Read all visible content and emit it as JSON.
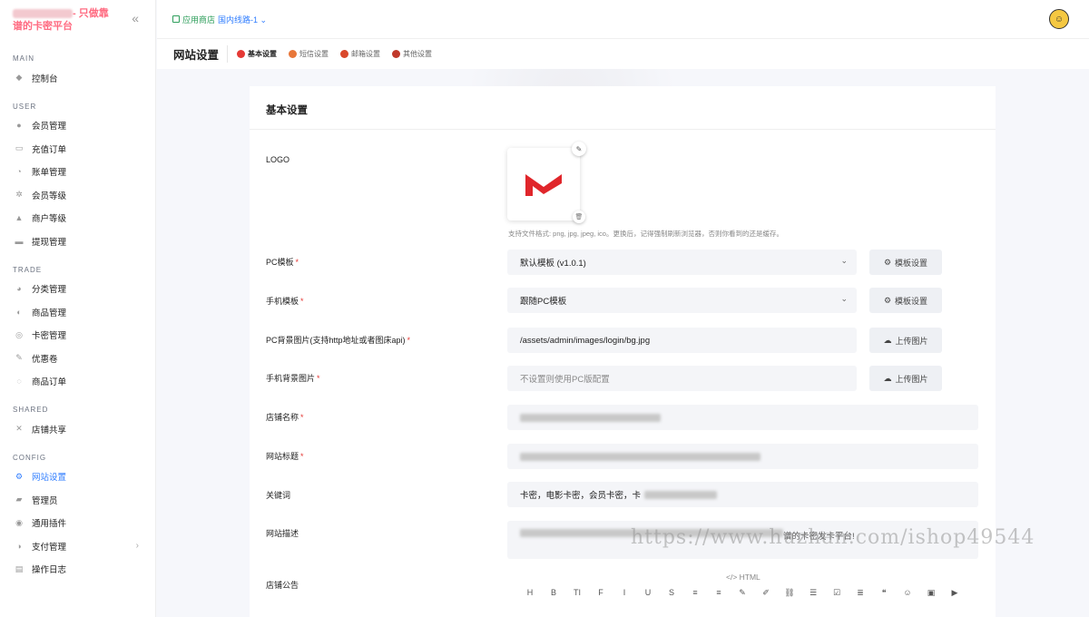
{
  "brand": {
    "text_visible": "- 只做靠谱的卡密平台"
  },
  "sidebar": {
    "sections": [
      {
        "title": "MAIN",
        "items": [
          {
            "label": "控制台",
            "icon": "dashboard-icon"
          }
        ]
      },
      {
        "title": "USER",
        "items": [
          {
            "label": "会员管理",
            "icon": "user-icon"
          },
          {
            "label": "充值订单",
            "icon": "recharge-icon"
          },
          {
            "label": "账单管理",
            "icon": "bill-icon"
          },
          {
            "label": "会员等级",
            "icon": "level-icon"
          },
          {
            "label": "商户等级",
            "icon": "merchant-icon"
          },
          {
            "label": "提现管理",
            "icon": "withdraw-icon"
          }
        ]
      },
      {
        "title": "TRADE",
        "items": [
          {
            "label": "分类管理",
            "icon": "category-icon"
          },
          {
            "label": "商品管理",
            "icon": "goods-icon"
          },
          {
            "label": "卡密管理",
            "icon": "card-icon"
          },
          {
            "label": "优惠卷",
            "icon": "coupon-icon"
          },
          {
            "label": "商品订单",
            "icon": "order-icon"
          }
        ]
      },
      {
        "title": "SHARED",
        "items": [
          {
            "label": "店铺共享",
            "icon": "share-icon"
          }
        ]
      },
      {
        "title": "CONFIG",
        "items": [
          {
            "label": "网站设置",
            "icon": "settings-icon",
            "active": true
          },
          {
            "label": "管理员",
            "icon": "admin-icon"
          },
          {
            "label": "通用插件",
            "icon": "plugin-icon"
          },
          {
            "label": "支付管理",
            "icon": "payment-icon",
            "has_arrow": true
          },
          {
            "label": "操作日志",
            "icon": "log-icon"
          }
        ]
      }
    ]
  },
  "topbar": {
    "app_store": "应用商店",
    "route": "国内线路-1"
  },
  "page": {
    "title": "网站设置",
    "tabs": [
      {
        "label": "基本设置",
        "active": true,
        "color": "#e53935"
      },
      {
        "label": "短信设置",
        "color": "#e8773a"
      },
      {
        "label": "邮箱设置",
        "color": "#d9482b"
      },
      {
        "label": "其他设置",
        "color": "#c0392b"
      }
    ]
  },
  "form": {
    "card_title": "基本设置",
    "logo_label": "LOGO",
    "logo_hint": "支持文件格式: png, jpg, jpeg, ico。更换后，记得强制刷新浏览器，否则你看到的还是缓存。",
    "pc_template": {
      "label": "PC模板",
      "value": "默认模板 (v1.0.1)",
      "button": "模板设置"
    },
    "mobile_template": {
      "label": "手机模板",
      "value": "跟随PC模板",
      "button": "模板设置"
    },
    "pc_bg": {
      "label": "PC背景图片(支持http地址或者图床api)",
      "value": "/assets/admin/images/login/bg.jpg",
      "button": "上传图片"
    },
    "mobile_bg": {
      "label": "手机背景图片",
      "placeholder": "不设置则使用PC版配置",
      "button": "上传图片"
    },
    "shop_name": {
      "label": "店铺名称"
    },
    "site_title": {
      "label": "网站标题"
    },
    "keywords": {
      "label": "关键词",
      "value": "卡密，电影卡密，会员卡密，卡"
    },
    "description": {
      "label": "网站描述",
      "tail": "谱的卡密发卡平台!"
    },
    "notice": {
      "label": "店铺公告",
      "editor_html": "</> HTML"
    }
  },
  "editor_toolbar": [
    "H",
    "B",
    "TI",
    "F",
    "I",
    "U",
    "S",
    "≡",
    "≡",
    "✎",
    "✐",
    "⛓",
    "☰",
    "☑",
    "≣",
    "❝",
    "☺",
    "▣",
    "▶"
  ],
  "watermark": "https://www.huzhan.com/ishop49544",
  "colors": {
    "accent": "#2f7dff",
    "required": "#e53935",
    "logo_red": "#e0262b"
  }
}
